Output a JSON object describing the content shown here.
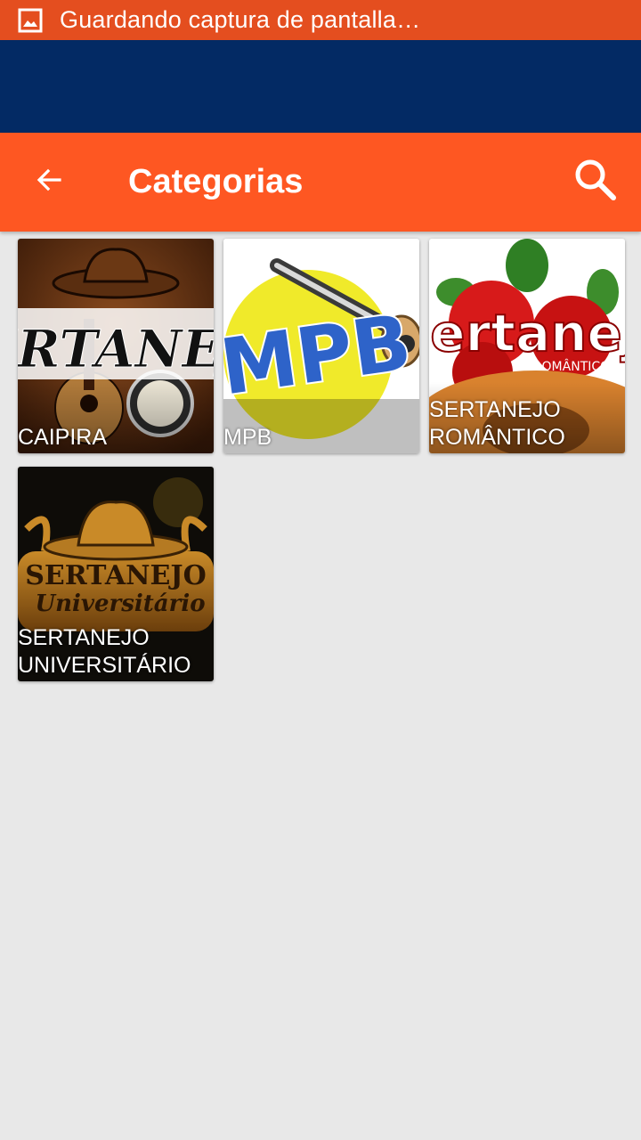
{
  "status_bar": {
    "icon": "image-icon",
    "text": "Guardando captura de pantalla…",
    "color": "#e44e1f"
  },
  "banner": {
    "color": "#032a64"
  },
  "toolbar": {
    "title": "Categorias",
    "back_icon": "arrow-back-icon",
    "search_icon": "search-icon",
    "color": "#fe5722"
  },
  "categories": [
    {
      "label": "CAIPIRA",
      "art_text": "SERTANEJO"
    },
    {
      "label": "MPB",
      "art_text": "MPB"
    },
    {
      "label": "SERTANEJO\nROMÂNTICO",
      "art_text": "Sertanejo",
      "art_subtext": "ROMÂNTICO"
    },
    {
      "label": "SERTANEJO\nUNIVERSITÁRIO",
      "art_text": "SERTANEJO",
      "art_subtext": "Universitário"
    }
  ]
}
